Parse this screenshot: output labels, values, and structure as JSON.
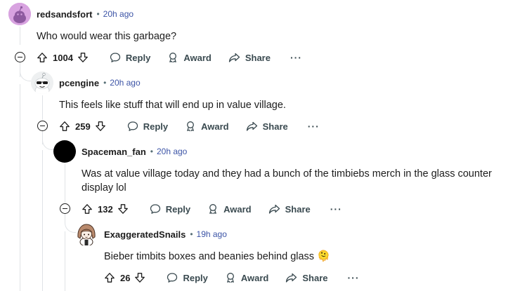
{
  "comments": [
    {
      "author": "redsandsfort",
      "time": "20h ago",
      "text": "Who would wear this garbage?",
      "score": "1004"
    },
    {
      "author": "pcengine",
      "time": "20h ago",
      "text": "This feels like stuff that will end up in value village.",
      "score": "259"
    },
    {
      "author": "Spaceman_fan",
      "time": "20h ago",
      "text": "Was at value village today and they had a bunch of the timbiebs merch in the glass counter display lol",
      "score": "132"
    },
    {
      "author": "ExaggeratedSnails",
      "time": "19h ago",
      "text": "Bieber timbits boxes and beanies behind glass",
      "emoji": "🫠",
      "score": "26"
    }
  ],
  "actions": {
    "reply": "Reply",
    "award": "Award",
    "share": "Share",
    "more": "···"
  },
  "meta_separator": "•",
  "colors": {
    "accent_time": "#3c54a6",
    "thread_line": "#e0e3e6",
    "action_text": "#3a4a50"
  },
  "icons": [
    "upvote-icon",
    "downvote-icon",
    "reply-icon",
    "award-icon",
    "share-icon",
    "collapse-icon"
  ]
}
